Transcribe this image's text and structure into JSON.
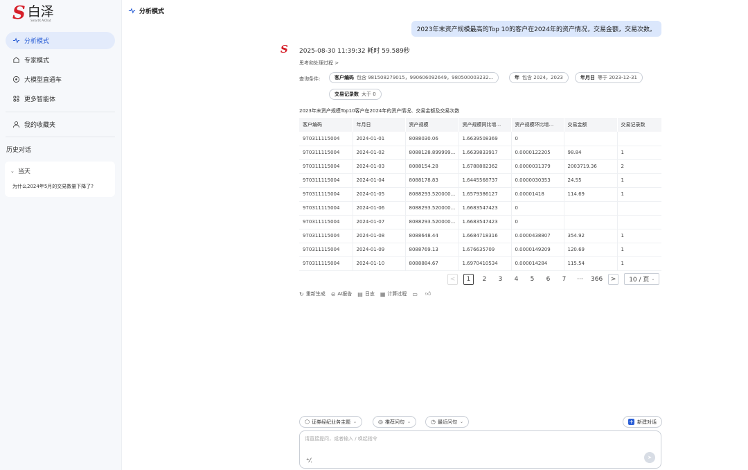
{
  "brand": {
    "name": "白泽",
    "sub": "SmartX AIChat",
    "logo_letter": "S",
    "color": "#d6202a"
  },
  "sidebar": {
    "items": [
      {
        "label": "分析模式",
        "icon": "analysis-icon",
        "active": true
      },
      {
        "label": "专家模式",
        "icon": "expert-icon"
      },
      {
        "label": "大模型直通车",
        "icon": "model-icon"
      },
      {
        "label": "更多智能体",
        "icon": "apps-icon"
      },
      {
        "label": "我的收藏夹",
        "icon": "user-icon"
      }
    ],
    "history_title": "历史对话",
    "history_group": "当天",
    "history_entry": "为什么2024年5月的交易数量下降了?"
  },
  "header": {
    "title": "分析模式"
  },
  "chat": {
    "user_message": "2023年末资产规模最高的Top 10的客户在2024年的资产情况，交易金额，交易次数。",
    "meta": "2025-08-30 11:39:32 耗时 59.589秒",
    "think_link": "思考和处理过程 >",
    "condition_label": "查询条件:",
    "chips": [
      {
        "key": "客户编码",
        "text": "包含 981508279015，990606092649，980500003232..."
      },
      {
        "key": "年",
        "text": "包含 2024，2023"
      },
      {
        "key": "年月日",
        "text": "等于 2023-12-31"
      },
      {
        "key": "交易记录数",
        "text": "大于 0"
      }
    ],
    "table_caption": "2023年末资产规模Top10客户在2024年的资产情况、交易金额及交易次数",
    "table": {
      "headers": [
        "客户编码",
        "年月日",
        "资产规模",
        "资产规模同比增...",
        "资产规模环比增...",
        "交易金额",
        "交易记录数"
      ],
      "rows": [
        [
          "970311115004",
          "2024-01-01",
          "8088030.06",
          "1.6639508369",
          "0",
          "",
          ""
        ],
        [
          "970311115004",
          "2024-01-02",
          "8088128.899999...",
          "1.6639833917",
          "0.0000122205",
          "98.84",
          "1"
        ],
        [
          "970311115004",
          "2024-01-03",
          "8088154.28",
          "1.6788882362",
          "0.0000031379",
          "2003719.36",
          "2"
        ],
        [
          "970311115004",
          "2024-01-04",
          "8088178.83",
          "1.6445568737",
          "0.0000030353",
          "24.55",
          "1"
        ],
        [
          "970311115004",
          "2024-01-05",
          "8088293.520000...",
          "1.6579386127",
          "0.00001418",
          "114.69",
          "1"
        ],
        [
          "970311115004",
          "2024-01-06",
          "8088293.520000...",
          "1.6683547423",
          "0",
          "",
          ""
        ],
        [
          "970311115004",
          "2024-01-07",
          "8088293.520000...",
          "1.6683547423",
          "0",
          "",
          ""
        ],
        [
          "970311115004",
          "2024-01-08",
          "8088648.44",
          "1.6684718316",
          "0.0000438807",
          "354.92",
          "1"
        ],
        [
          "970311115004",
          "2024-01-09",
          "8088769.13",
          "1.676635709",
          "0.0000149209",
          "120.69",
          "1"
        ],
        [
          "970311115004",
          "2024-01-10",
          "8088884.67",
          "1.6970410534",
          "0.000014284",
          "115.54",
          "1"
        ]
      ]
    },
    "pagination": {
      "prev": "<",
      "pages": [
        "1",
        "2",
        "3",
        "4",
        "5",
        "6",
        "7",
        "···",
        "366"
      ],
      "next": ">",
      "page_size": "10 / 页"
    },
    "actions": [
      {
        "label": "重新生成",
        "icon": "refresh-icon"
      },
      {
        "label": "AI报告",
        "icon": "report-icon"
      },
      {
        "label": "日志",
        "icon": "log-icon"
      },
      {
        "label": "计算过程",
        "icon": "calc-icon"
      }
    ]
  },
  "composer": {
    "pills": [
      {
        "label": "证券经纪业务主题",
        "icon": "topic-icon"
      },
      {
        "label": "推荐问句",
        "icon": "suggest-icon"
      },
      {
        "label": "最近问句",
        "icon": "recent-icon"
      }
    ],
    "new_chat": "新建对话",
    "placeholder": "请直接提问，或者输入 / 唤起指令"
  }
}
